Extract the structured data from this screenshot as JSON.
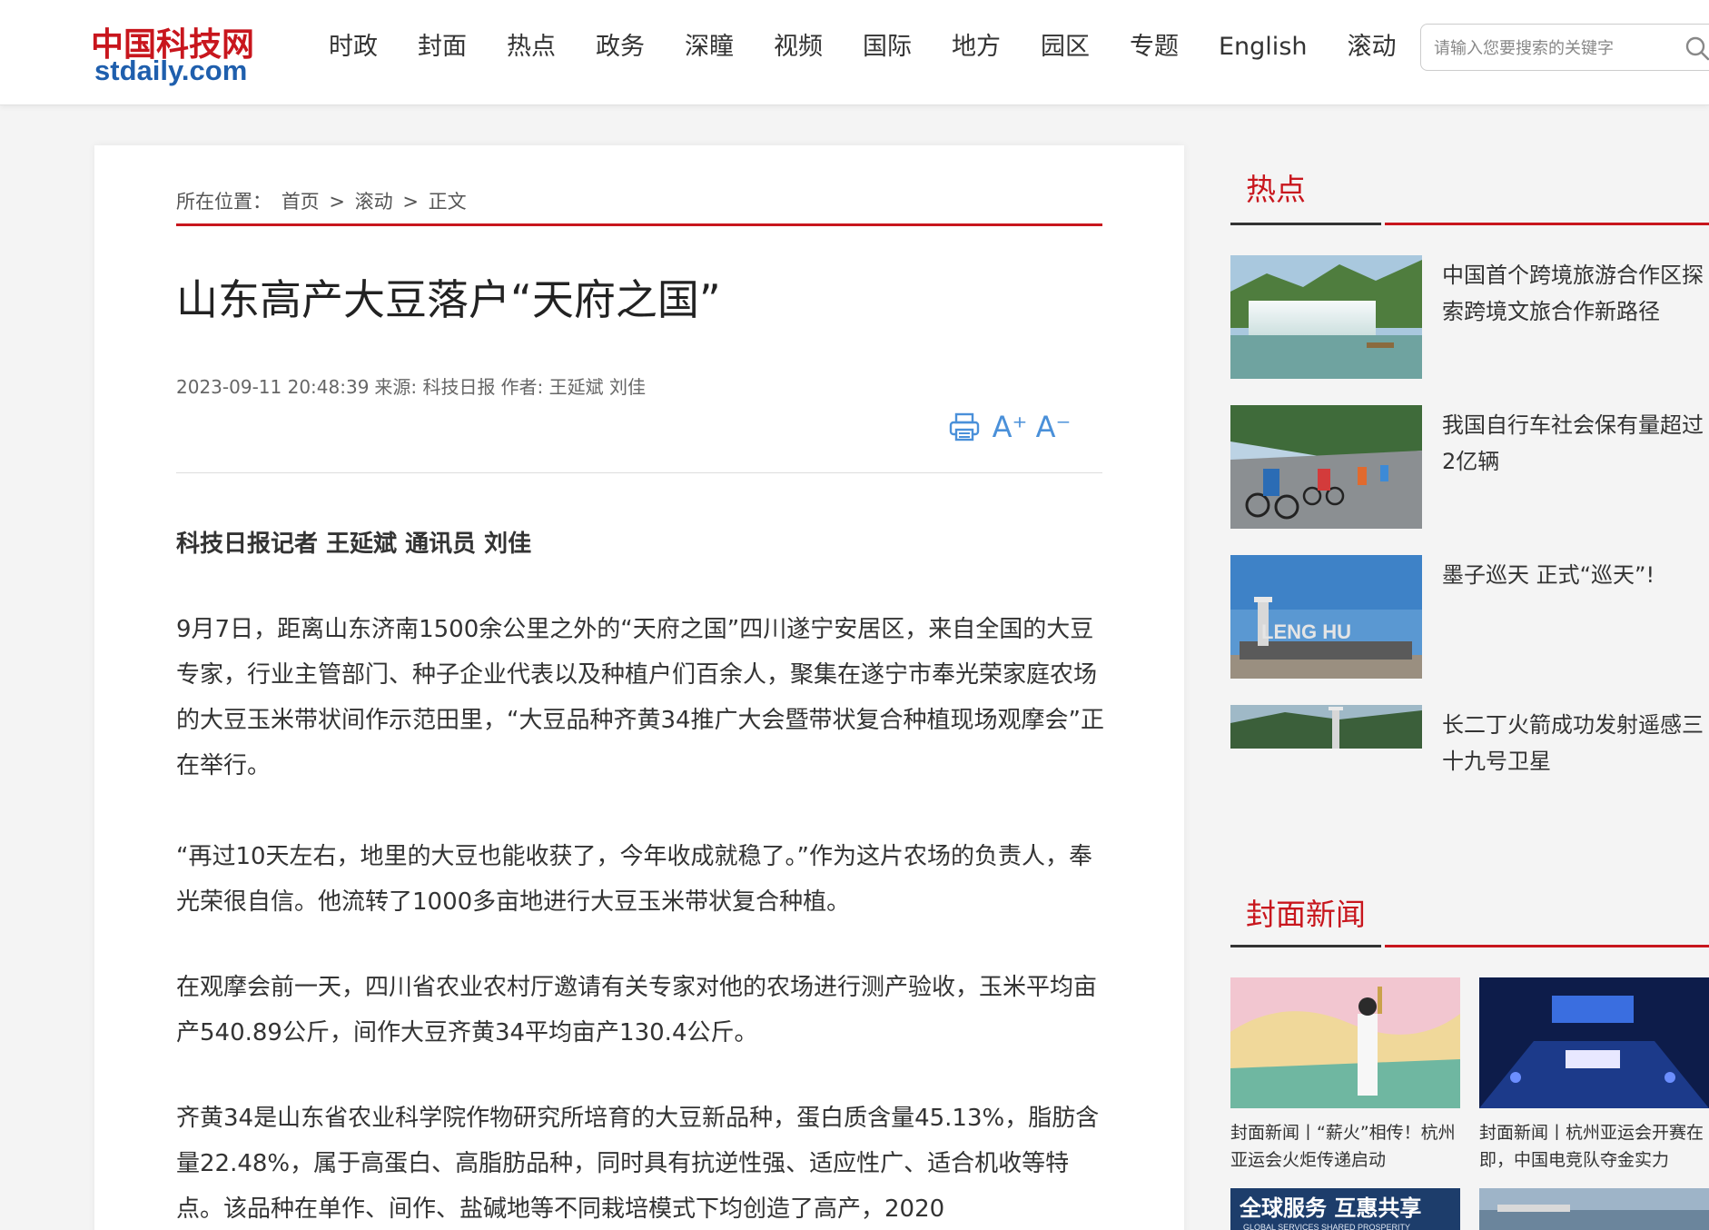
{
  "header": {
    "logo_cn": "中国科技网",
    "logo_en": "stdaily.com",
    "nav": [
      "时政",
      "封面",
      "热点",
      "政务",
      "深瞳",
      "视频",
      "国际",
      "地方",
      "园区",
      "专题",
      "English",
      "滚动"
    ],
    "search_placeholder": "请输入您要搜索的关键字"
  },
  "breadcrumb": {
    "prefix": "所在位置：",
    "items": [
      "首页",
      "滚动",
      "正文"
    ],
    "sep": ">"
  },
  "article": {
    "title": "山东高产大豆落户“天府之国”",
    "datetime": "2023-09-11 20:48:39",
    "source": "来源: 科技日报",
    "author": "作者: 王延斌 刘佳",
    "byline": "科技日报记者 王延斌 通讯员 刘佳",
    "paragraphs": [
      "9月7日，距离山东济南1500余公里之外的“天府之国”四川遂宁安居区，来自全国的大豆专家，行业主管部门、种子企业代表以及种植户们百余人，聚集在遂宁市奉光荣家庭农场的大豆玉米带状间作示范田里，“大豆品种齐黄34推广大会暨带状复合种植现场观摩会”正在举行。",
      "“再过10天左右，地里的大豆也能收获了，今年收成就稳了。”作为这片农场的负责人，奉光荣很自信。他流转了1000多亩地进行大豆玉米带状复合种植。",
      "在观摩会前一天，四川省农业农村厅邀请有关专家对他的农场进行测产验收，玉米平均亩产540.89公斤，间作大豆齐黄34平均亩产130.4公斤。",
      "齐黄34是山东省农业科学院作物研究所培育的大豆新品种，蛋白质含量45.13%，脂肪含量22.48%，属于高蛋白、高脂肪品种，同时具有抗逆性强、适应性广、适合机收等特点。该品种在单作、间作、盐碱地等不同栽培模式下均创造了高产，2020"
    ]
  },
  "tools": {
    "print_icon": "printer-icon",
    "font_up": "A⁺",
    "font_down": "A⁻"
  },
  "sidebar": {
    "hot_title": "热点",
    "hot_items": [
      "中国首个跨境旅游合作区探索跨境文旅合作新路径",
      "我国自行车社会保有量超过2亿辆",
      "墨子巡天 正式“巡天”!",
      "长二丁火箭成功发射遥感三十九号卫星"
    ],
    "cover_title": "封面新闻",
    "cover_items": [
      "封面新闻丨“薪火”相传！杭州亚运会火炬传递启动",
      "封面新闻丨杭州亚运会开赛在即，中国电竞队夺金实力"
    ],
    "banner_text": "全球服务 互惠共享",
    "banner_sub": "GLOBAL SERVICES SHARED PROSPERITY",
    "lenghu_sign": "LENG HU"
  }
}
